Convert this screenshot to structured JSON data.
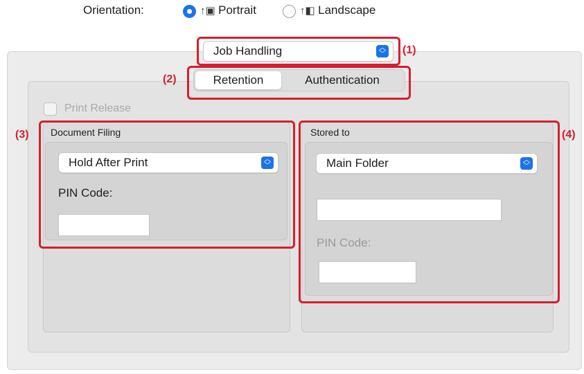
{
  "orientation": {
    "label": "Orientation:",
    "options": [
      {
        "label": "Portrait",
        "selected": true,
        "icon": "portrait-orientation-icon",
        "glyph": "↑▣"
      },
      {
        "label": "Landscape",
        "selected": false,
        "icon": "landscape-orientation-icon",
        "glyph": "↑◧"
      }
    ]
  },
  "panel_menu": {
    "value": "Job Handling"
  },
  "tabs": [
    {
      "label": "Retention",
      "selected": true
    },
    {
      "label": "Authentication",
      "selected": false
    }
  ],
  "print_release": {
    "label": "Print Release",
    "checked": false,
    "enabled": false
  },
  "document_filing": {
    "title": "Document Filing",
    "mode": "Hold After Print",
    "pin_label": "PIN Code:",
    "pin_value": ""
  },
  "stored_to": {
    "title": "Stored to",
    "folder": "Main Folder",
    "folder_name_value": "",
    "pin_label": "PIN Code:",
    "pin_value": ""
  },
  "callouts": [
    "(1)",
    "(2)",
    "(3)",
    "(4)"
  ],
  "colors": {
    "accent": "#1a73e8",
    "callout_red": "#d41f2e",
    "panel_bg": "#ececec"
  }
}
